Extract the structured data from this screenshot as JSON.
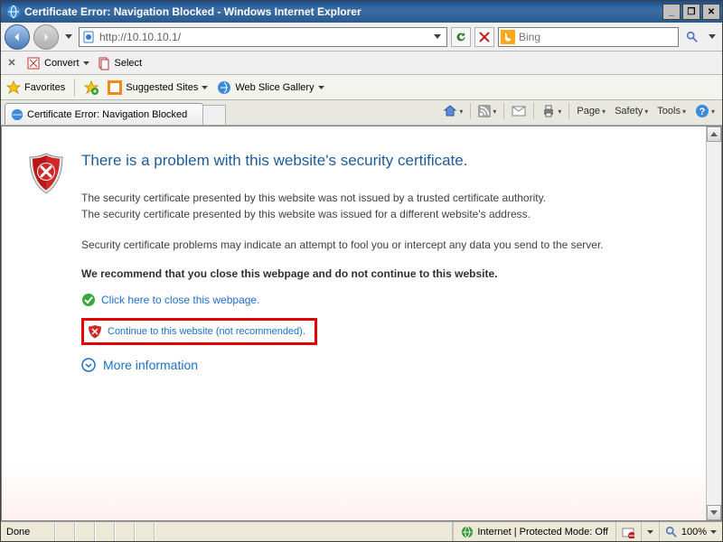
{
  "window": {
    "title": "Certificate Error: Navigation Blocked - Windows Internet Explorer"
  },
  "nav": {
    "url": "http://10.10.10.1/",
    "search_placeholder": "Bing"
  },
  "convert_bar": {
    "convert_label": "Convert",
    "select_label": "Select"
  },
  "favorites_bar": {
    "favorites_label": "Favorites",
    "suggested_sites_label": "Suggested Sites",
    "web_slice_label": "Web Slice Gallery"
  },
  "tab": {
    "title": "Certificate Error: Navigation Blocked"
  },
  "command_bar": {
    "page_label": "Page",
    "safety_label": "Safety",
    "tools_label": "Tools"
  },
  "cert": {
    "heading": "There is a problem with this website's security certificate.",
    "line1": "The security certificate presented by this website was not issued by a trusted certificate authority.",
    "line2": "The security certificate presented by this website was issued for a different website's address.",
    "line3": "Security certificate problems may indicate an attempt to fool you or intercept any data you send to the server.",
    "recommend": "We recommend that you close this webpage and do not continue to this website.",
    "close_link": "Click here to close this webpage.",
    "continue_link": "Continue to this website (not recommended).",
    "more_info": "More information"
  },
  "status": {
    "done": "Done",
    "zone": "Internet | Protected Mode: Off",
    "zoom": "100%"
  }
}
